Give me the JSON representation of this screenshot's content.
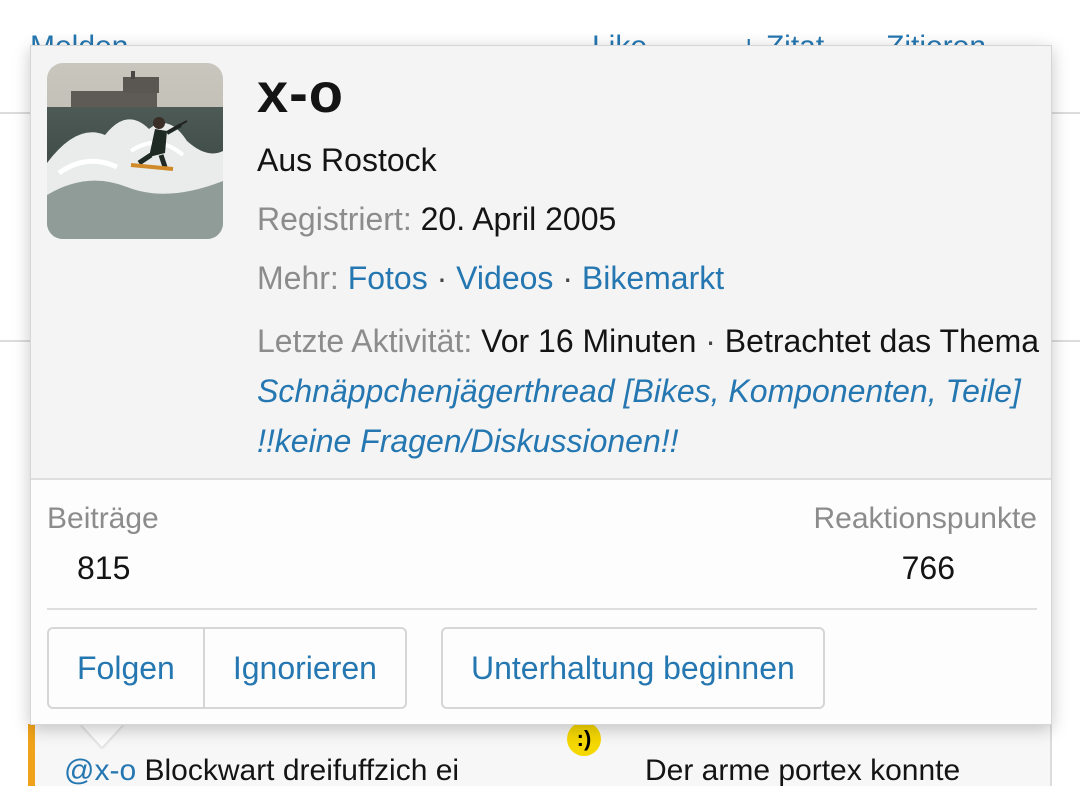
{
  "background": {
    "actions": [
      "Melden",
      "Like",
      "+ Zitat",
      "Zitieren"
    ],
    "post": {
      "mention": "@x-o",
      "text_left": "Blockwart dreifuffzich ei",
      "text_right": "Der arme portex konnte"
    }
  },
  "profile": {
    "username": "x-o",
    "location": "Aus Rostock",
    "registered_label": "Registriert:",
    "registered_value": "20. April 2005",
    "more_label": "Mehr:",
    "more_links": [
      "Fotos",
      "Videos",
      "Bikemarkt"
    ],
    "separator": "·",
    "activity_label": "Letzte Aktivität:",
    "activity_time": "Vor 16 Minuten",
    "activity_action": "Betrachtet das Thema",
    "activity_thread": "Schnäppchenjägerthread [Bikes, Komponenten, Teile] !!keine Fragen/Diskussionen!!"
  },
  "stats": {
    "posts_label": "Beiträge",
    "posts_value": "815",
    "reactions_label": "Reaktionspunkte",
    "reactions_value": "766"
  },
  "buttons": {
    "follow": "Folgen",
    "ignore": "Ignorieren",
    "conversation": "Unterhaltung beginnen"
  },
  "colors": {
    "link": "#2577b1",
    "muted": "#8c8c8c",
    "accent_bar": "#f0a31a",
    "header_bg": "#f4f4f4"
  }
}
